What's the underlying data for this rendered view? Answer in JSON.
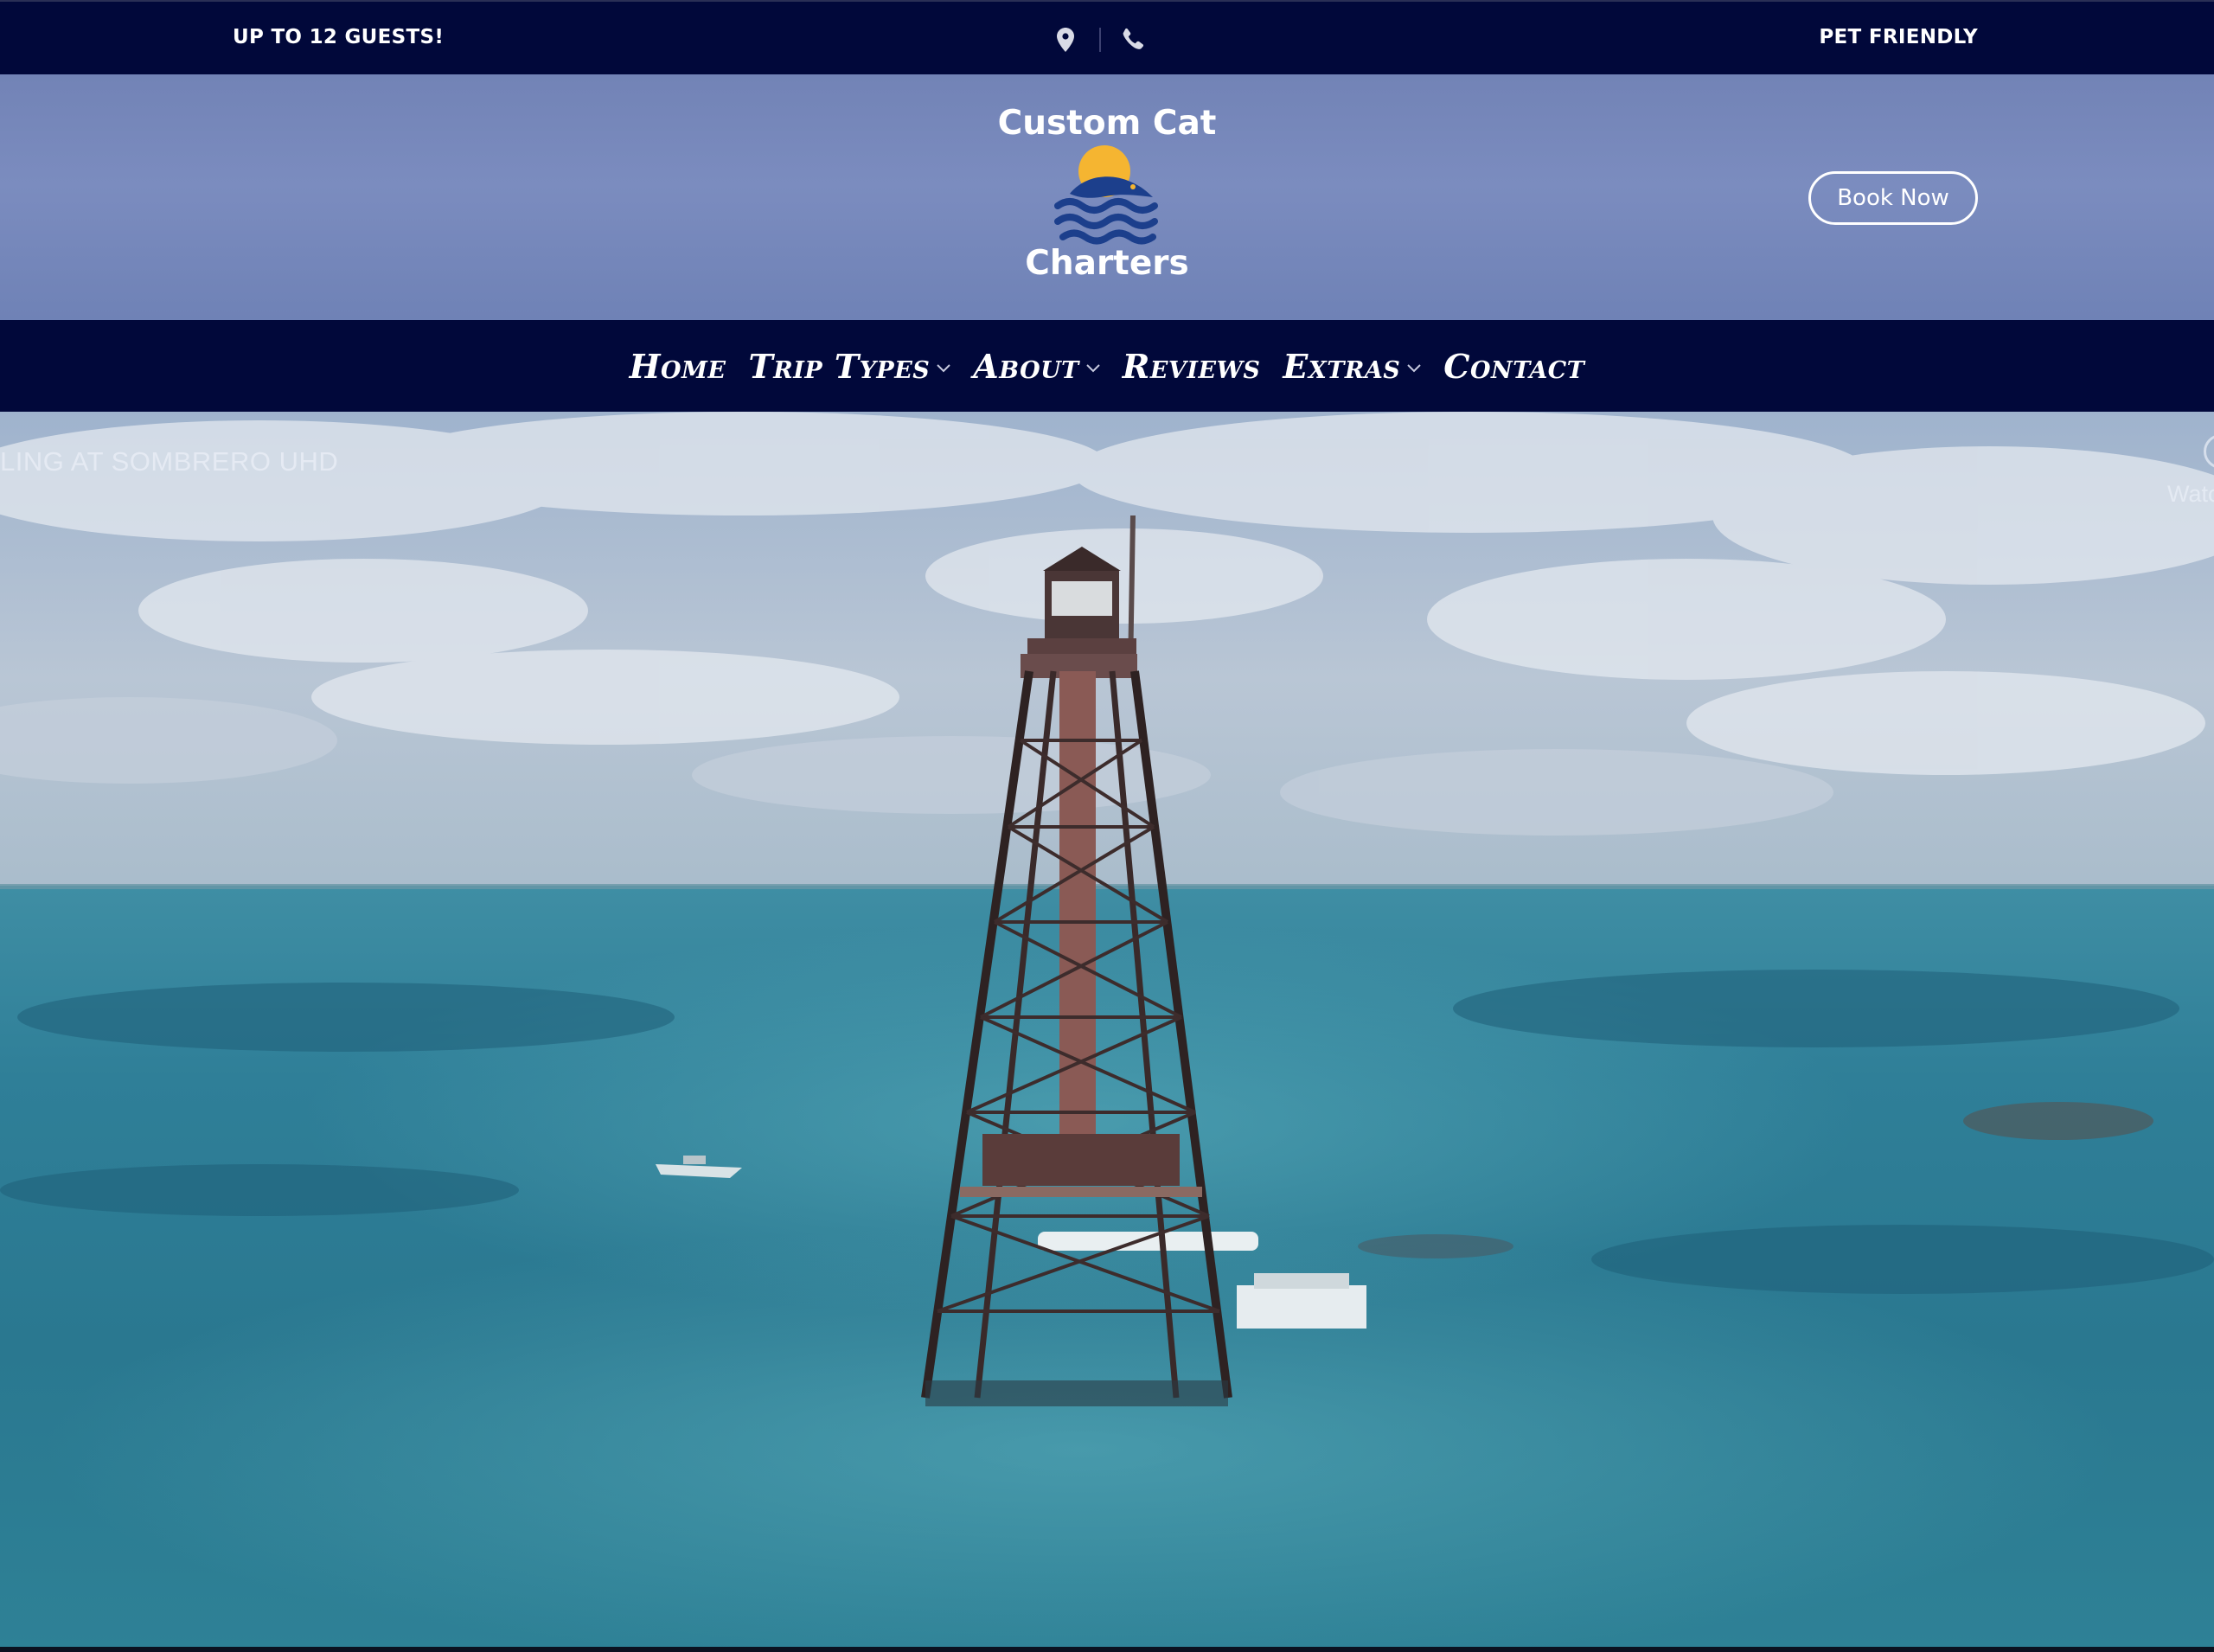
{
  "topbar": {
    "left_text": "UP TO 12 GUESTS!",
    "right_text": "PET FRIENDLY",
    "icons": [
      "location-pin-icon",
      "phone-icon"
    ]
  },
  "header": {
    "logo_line1": "Custom Cat",
    "logo_line2": "Charters",
    "book_now": "Book Now"
  },
  "nav": {
    "items": [
      {
        "label": "Home",
        "dropdown": false
      },
      {
        "label": "Trip Types",
        "dropdown": true
      },
      {
        "label": "About",
        "dropdown": true
      },
      {
        "label": "Reviews",
        "dropdown": false
      },
      {
        "label": "Extras",
        "dropdown": true
      },
      {
        "label": "Contact",
        "dropdown": false
      }
    ]
  },
  "hero": {
    "video_title": "LING AT SOMBRERO UHD",
    "watch_later": "Watc"
  },
  "colors": {
    "topbar_bg": "#01083a",
    "header_bg": "#7586ba",
    "logo_sun": "#f5b531",
    "logo_waves": "#1c3f8c"
  }
}
